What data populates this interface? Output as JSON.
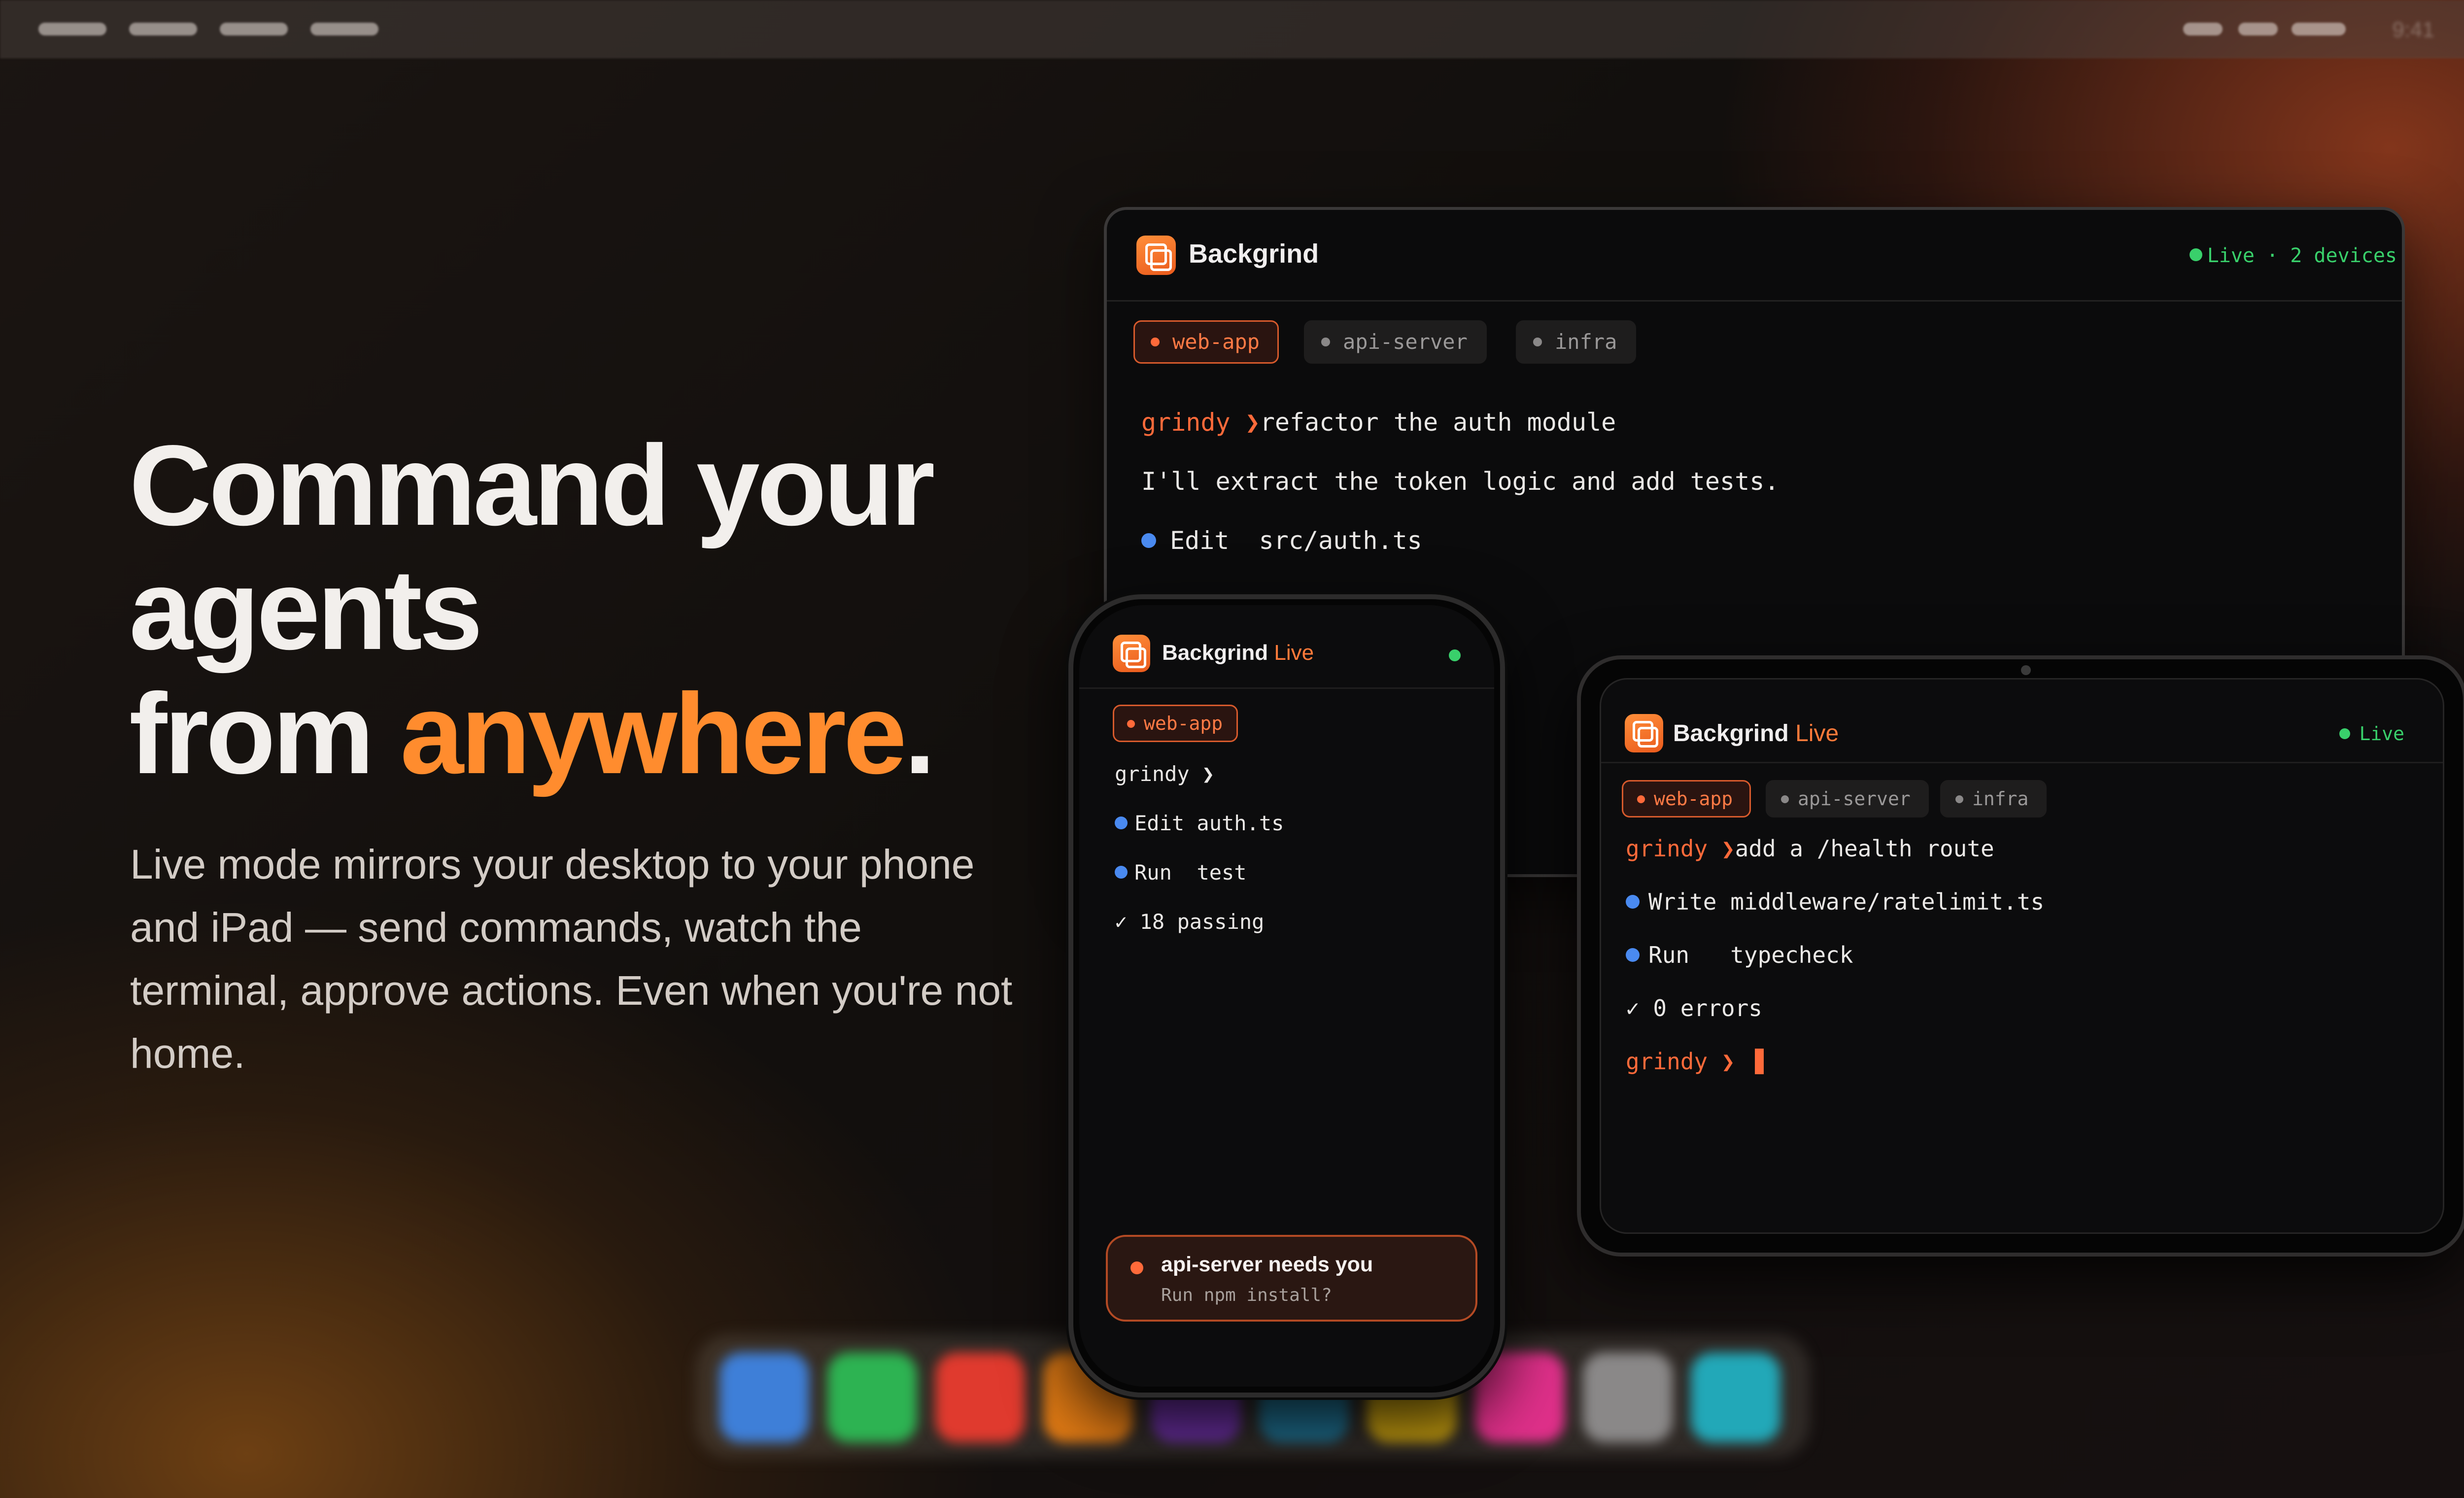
{
  "menubar": {
    "time": "9:41"
  },
  "hero": {
    "title_line1": "Command your",
    "title_line2": "agents",
    "title_line3_prefix": "from ",
    "title_accent": "anywhere",
    "title_period": ".",
    "subtitle": "Live mode mirrors your desktop to your phone and iPad — send commands, watch the terminal, approve actions. Even when you're not home."
  },
  "desktop": {
    "app_title": "Backgrind",
    "status": "Live · 2 devices",
    "tabs": [
      {
        "label": "web-app",
        "active": true
      },
      {
        "label": "api-server",
        "active": false
      },
      {
        "label": "infra",
        "active": false
      }
    ],
    "prompt": "grindy ❯",
    "command": "refactor the auth module",
    "reply": "I'll extract the token logic and add tests.",
    "action_verb": "Edit",
    "action_target": "src/auth.ts"
  },
  "phone": {
    "app_title": "Backgrind",
    "live_label": "Live",
    "tab": "web-app",
    "prompt": "grindy ❯",
    "line1": "Edit auth.ts",
    "line2_verb": "Run",
    "line2_target": "test",
    "check": "✓",
    "result": "18 passing",
    "notification": {
      "title": "api-server needs you",
      "subtitle": "Run npm install?"
    }
  },
  "tablet": {
    "app_title": "Backgrind",
    "live_label": "Live",
    "status": "Live",
    "tabs": [
      {
        "label": "web-app",
        "active": true
      },
      {
        "label": "api-server",
        "active": false
      },
      {
        "label": "infra",
        "active": false
      }
    ],
    "prompt": "grindy ❯",
    "command": "add a /health route",
    "line1_verb": "Write",
    "line1_target": "middleware/ratelimit.ts",
    "line2_verb": "Run",
    "line2_target": "typecheck",
    "check": "✓",
    "result": "0 errors",
    "prompt2": "grindy ❯"
  },
  "dock": {
    "icons": [
      "#3e7fd8",
      "#2db352",
      "#e03a2e",
      "#e07a14",
      "#6a2fa0",
      "#1f6f8f",
      "#c9a010",
      "#e0308a",
      "#8a8888",
      "#22a8b8"
    ]
  },
  "colors": {
    "accent": "#ff8c2e",
    "prompt": "#ff6a3a",
    "live_green": "#39d06b",
    "tool_blue": "#4a8af0"
  }
}
